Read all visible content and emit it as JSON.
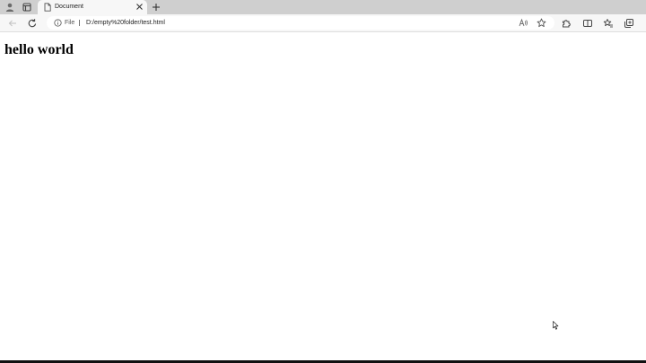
{
  "browser": {
    "tab": {
      "title": "Document"
    },
    "address_bar": {
      "scheme_label": "File",
      "url": "D:/empty%20folder/test.html"
    }
  },
  "page": {
    "heading": "hello world"
  },
  "colors": {
    "tab_strip": "#cfcfcf",
    "toolbar": "#f7f7f7",
    "page_background": "#ffffff"
  }
}
